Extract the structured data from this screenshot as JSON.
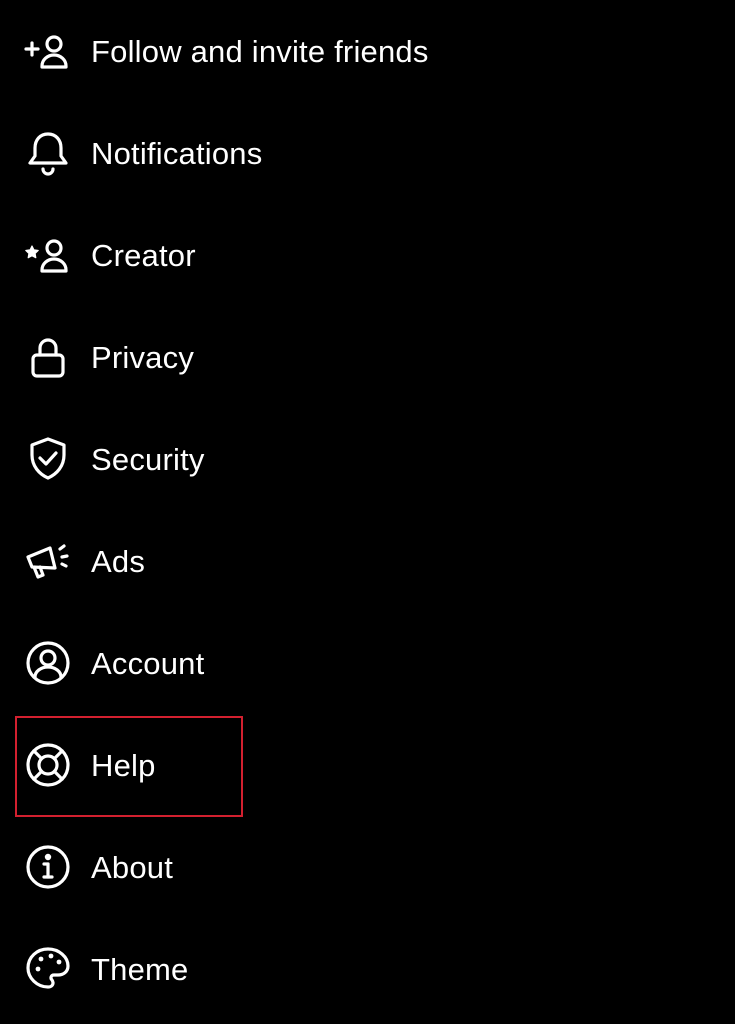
{
  "theme": {
    "background": "#000000",
    "text": "#ffffff",
    "highlight_border": "#d3202f"
  },
  "menu": {
    "items": [
      {
        "id": "follow",
        "label": "Follow and invite friends",
        "icon": "add-person-icon"
      },
      {
        "id": "notifications",
        "label": "Notifications",
        "icon": "bell-icon"
      },
      {
        "id": "creator",
        "label": "Creator",
        "icon": "star-person-icon"
      },
      {
        "id": "privacy",
        "label": "Privacy",
        "icon": "lock-icon"
      },
      {
        "id": "security",
        "label": "Security",
        "icon": "shield-check-icon"
      },
      {
        "id": "ads",
        "label": "Ads",
        "icon": "megaphone-icon"
      },
      {
        "id": "account",
        "label": "Account",
        "icon": "account-circle-icon"
      },
      {
        "id": "help",
        "label": "Help",
        "icon": "lifebuoy-icon",
        "highlighted": true
      },
      {
        "id": "about",
        "label": "About",
        "icon": "info-circle-icon"
      },
      {
        "id": "theme",
        "label": "Theme",
        "icon": "palette-icon"
      }
    ]
  }
}
